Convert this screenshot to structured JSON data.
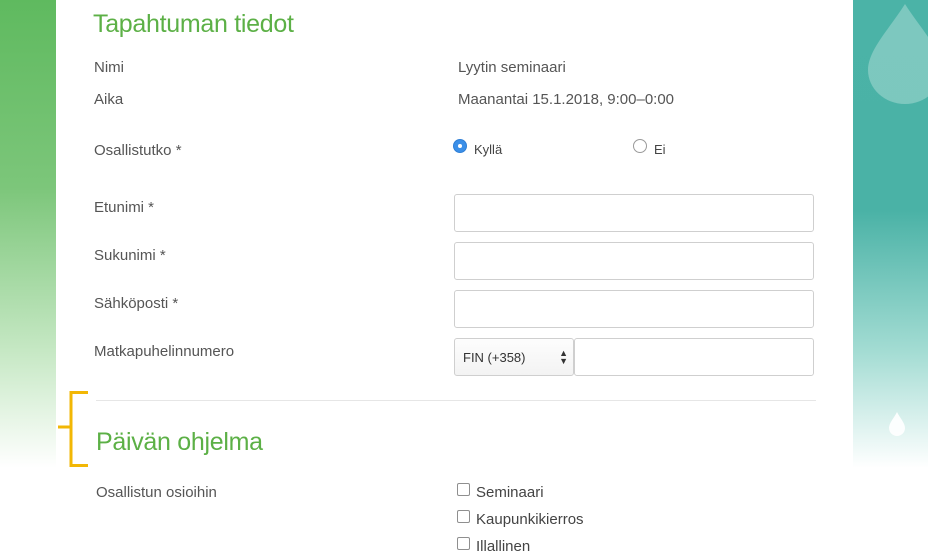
{
  "event_details": {
    "title": "Tapahtuman tiedot",
    "name_label": "Nimi",
    "name_value": "Lyytin seminaari",
    "time_label": "Aika",
    "time_value": "Maanantai 15.1.2018, 9:00–0:00"
  },
  "participation": {
    "label": "Osallistutko *",
    "options": [
      {
        "label": "Kyllä",
        "selected": true
      },
      {
        "label": "Ei",
        "selected": false
      }
    ]
  },
  "form": {
    "first_name_label": "Etunimi *",
    "first_name_value": "",
    "last_name_label": "Sukunimi *",
    "last_name_value": "",
    "email_label": "Sähköposti *",
    "email_value": "",
    "phone_label": "Matkapuhelinnumero",
    "phone_country": "FIN (+358)",
    "phone_value": ""
  },
  "program": {
    "title": "Päivän ohjelma",
    "label": "Osallistun osioihin",
    "options": [
      {
        "label": "Seminaari",
        "checked": false
      },
      {
        "label": "Kaupunkikierros",
        "checked": false
      },
      {
        "label": "Illallinen",
        "checked": false
      }
    ]
  },
  "colors": {
    "accent_green": "#5cb046",
    "radio_blue": "#3b8fe8",
    "bracket_yellow": "#f2b705",
    "bg_left_green": "#5fba5f",
    "bg_right_teal": "#4bb3a7"
  }
}
